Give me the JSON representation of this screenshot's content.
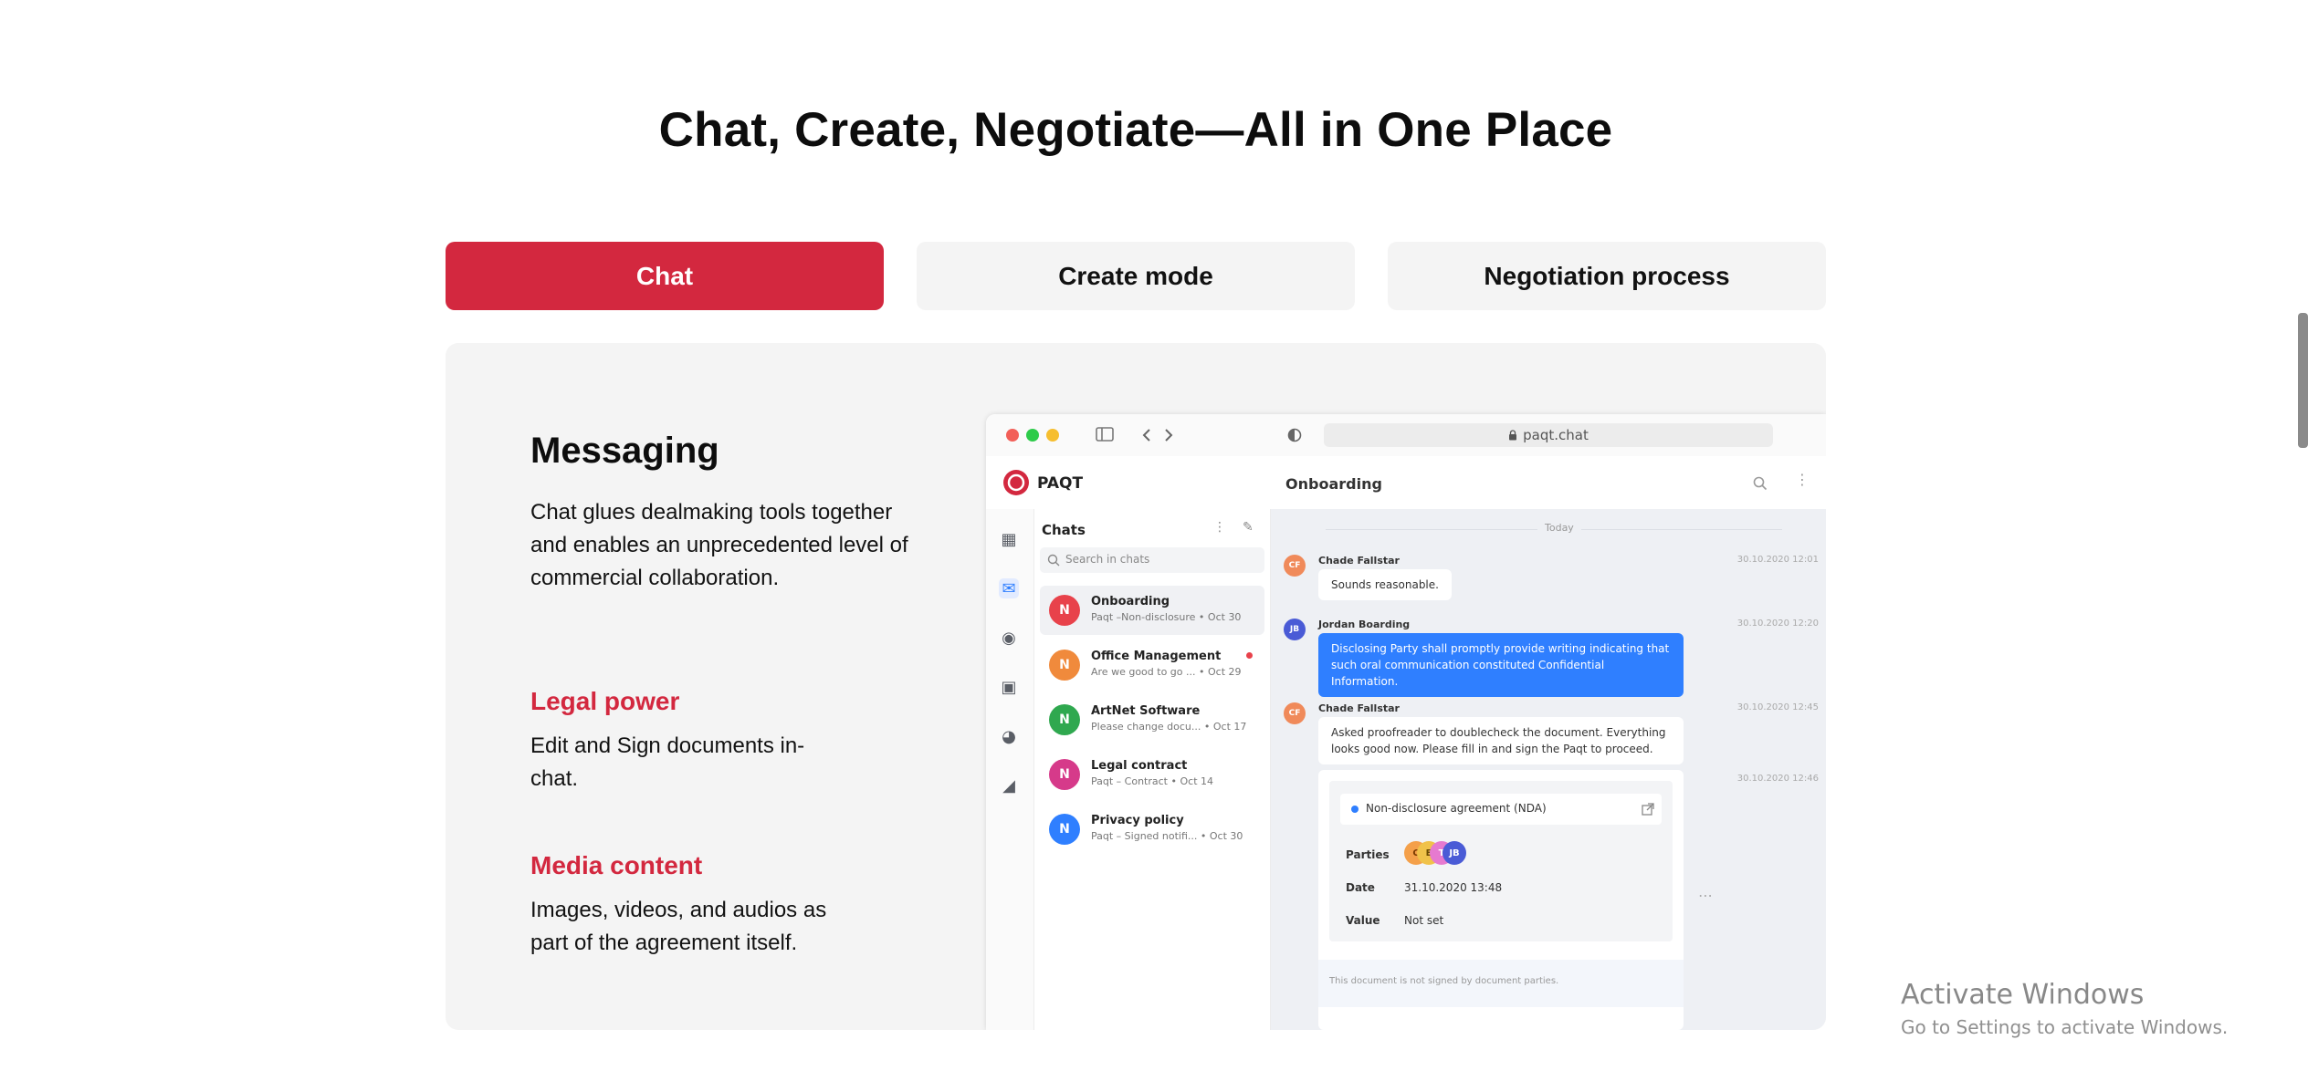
{
  "heading": "Chat, Create, Negotiate—All in One Place",
  "tabs": [
    {
      "label": "Chat",
      "active": true
    },
    {
      "label": "Create mode",
      "active": false
    },
    {
      "label": "Negotiation process",
      "active": false
    }
  ],
  "features": {
    "messaging": {
      "title": "Messaging",
      "text": "Chat glues dealmaking tools together and enables an unprecedented level of commercial collaboration."
    },
    "legal": {
      "title": "Legal power",
      "text": "Edit and Sign documents in-chat."
    },
    "media": {
      "title": "Media content",
      "text": "Images, videos, and audios as part of the agreement itself."
    }
  },
  "colors": {
    "accent": "#d3283f",
    "tab_inactive_bg": "#f4f4f4",
    "panel_bg": "#f4f4f4"
  },
  "app": {
    "url": "paqt.chat",
    "brand": "PAQT",
    "conversation_title": "Onboarding",
    "chats_header": "Chats",
    "search_placeholder": "Search in chats",
    "chat_list": [
      {
        "initial": "N",
        "name": "Onboarding",
        "sub": "Paqt –Non-disclosure",
        "date": "Oct 30",
        "color": "#e8424b",
        "unread": false
      },
      {
        "initial": "N",
        "name": "Office Management",
        "sub": "Are we good to go ...",
        "date": "Oct 29",
        "color": "#f08a3c",
        "unread": true
      },
      {
        "initial": "N",
        "name": "ArtNet Software",
        "sub": "Please change docu...",
        "date": "Oct 17",
        "color": "#2fa84f",
        "unread": false
      },
      {
        "initial": "N",
        "name": "Legal contract",
        "sub": "Paqt – Contract",
        "date": "Oct 14",
        "color": "#d63a8a",
        "unread": false
      },
      {
        "initial": "N",
        "name": "Privacy policy",
        "sub": "Paqt – Signed notifi...",
        "date": "Oct 30",
        "color": "#2f7fff",
        "unread": false
      }
    ],
    "day_label": "Today",
    "messages": [
      {
        "initials": "CF",
        "author": "Chade Fallstar",
        "time": "30.10.2020 12:01",
        "text": "Sounds reasonable.",
        "color": "#f08a5a"
      },
      {
        "initials": "JB",
        "author": "Jordan Boarding",
        "time": "30.10.2020 12:20",
        "text": "Disclosing Party shall promptly provide writing indicating that such oral communication constituted Confidential Information.",
        "color": "#4a5bd6"
      },
      {
        "initials": "CF",
        "author": "Chade Fallstar",
        "time": "30.10.2020 12:45",
        "text": "Asked proofreader to doublecheck the document. Everything looks good now. Please fill in and sign the Paqt to proceed.",
        "color": "#f08a5a"
      }
    ],
    "doc_card": {
      "time": "30.10.2020 12:46",
      "doc_title": "Non-disclosure agreement (NDA)",
      "parties_label": "Parties",
      "party_initials": [
        "C",
        "E",
        "T",
        "JB"
      ],
      "date_label": "Date",
      "date_value": "31.10.2020 13:48",
      "value_label": "Value",
      "value_value": "Not set",
      "footer": "This document is not signed by document parties."
    }
  },
  "watermark": {
    "title": "Activate Windows",
    "sub": "Go to Settings to activate Windows."
  }
}
